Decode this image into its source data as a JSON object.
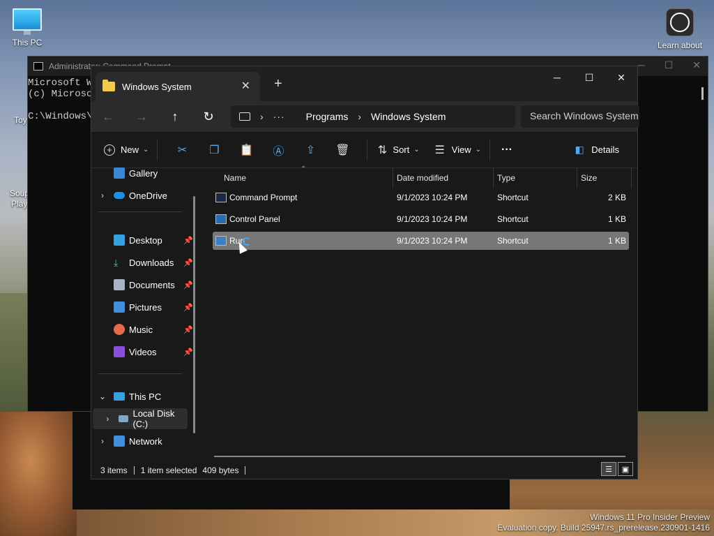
{
  "desktop": {
    "icons": {
      "this_pc": "This PC",
      "learn_about": "Learn about"
    },
    "peek": {
      "toy": "Toy",
      "soup": "Soup",
      "play": "Play"
    },
    "watermark": {
      "line1": "Windows 11 Pro Insider Preview",
      "line2": "Evaluation copy. Build 25947.rs_prerelease.230901-1416"
    }
  },
  "cmd": {
    "title": "Administrator: Command Prompt",
    "lines": [
      "Microsoft Wi",
      "(c) Microsof",
      "",
      "C:\\Windows\\S"
    ]
  },
  "explorer": {
    "tab_title": "Windows System",
    "new_tab": "+",
    "window_controls": {
      "minimize": "─",
      "maximize": "☐",
      "close": "✕"
    },
    "address": {
      "overflow": "···",
      "crumbs": [
        "Programs",
        "Windows System"
      ],
      "search_placeholder": "Search Windows System"
    },
    "toolbar": {
      "new": "New",
      "sort": "Sort",
      "view": "View",
      "more": "···",
      "details": "Details"
    },
    "nav": {
      "gallery": "Gallery",
      "onedrive": "OneDrive",
      "desktop": "Desktop",
      "downloads": "Downloads",
      "documents": "Documents",
      "pictures": "Pictures",
      "music": "Music",
      "videos": "Videos",
      "this_pc": "This PC",
      "local_disk": "Local Disk (C:)",
      "network": "Network"
    },
    "columns": {
      "name": "Name",
      "date": "Date modified",
      "type": "Type",
      "size": "Size"
    },
    "files": [
      {
        "name": "Command Prompt",
        "date": "9/1/2023 10:24 PM",
        "type": "Shortcut",
        "size": "2 KB"
      },
      {
        "name": "Control Panel",
        "date": "9/1/2023 10:24 PM",
        "type": "Shortcut",
        "size": "1 KB"
      },
      {
        "name": "Run",
        "date": "9/1/2023 10:24 PM",
        "type": "Shortcut",
        "size": "1 KB"
      }
    ],
    "status": {
      "count": "3 items",
      "selected": "1 item selected",
      "bytes": "409 bytes"
    }
  },
  "colors": {
    "accent": "#5aa9e6",
    "folder": "#f7c948",
    "selection": "#777777"
  }
}
